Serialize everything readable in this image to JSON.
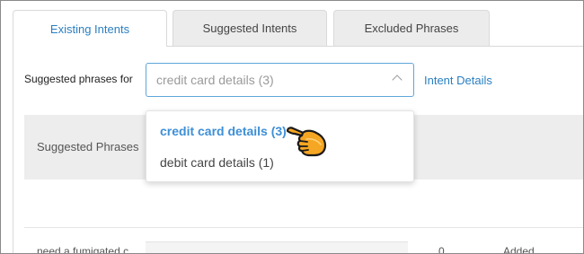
{
  "tabs": [
    {
      "label": "Existing Intents",
      "active": true
    },
    {
      "label": "Suggested Intents",
      "active": false
    },
    {
      "label": "Excluded Phrases",
      "active": false
    }
  ],
  "filter": {
    "label": "Suggested phrases for",
    "selected_value": "credit card details (3)",
    "intent_details_link": "Intent Details"
  },
  "dropdown": {
    "options": [
      {
        "label": "credit card details (3)",
        "selected": true
      },
      {
        "label": "debit card details (1)",
        "selected": false
      }
    ]
  },
  "table": {
    "header_label": "Suggested Phrases",
    "peek_row": {
      "phrase": "need a fumigated c",
      "count": "0",
      "status": "Added"
    }
  },
  "colors": {
    "accent": "#2a7fc1",
    "selected_option": "#3d8fd6",
    "cursor": "#f5a623"
  },
  "icons": {
    "dropdown_arrow": "chevron-up-icon",
    "cursor": "pointing-hand-cursor-icon"
  }
}
